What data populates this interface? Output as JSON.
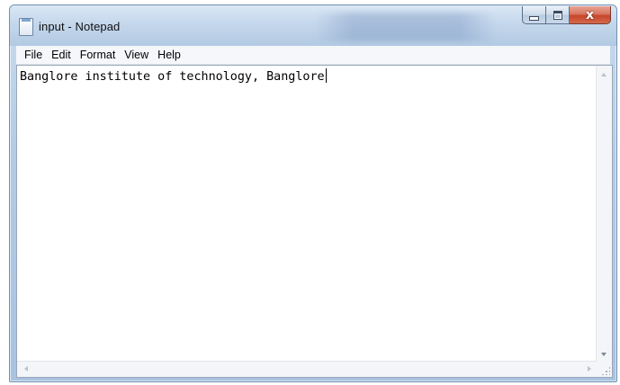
{
  "window": {
    "title": "input - Notepad",
    "close_glyph": "x",
    "icons": {
      "app": "notepad-icon",
      "minimize": "minimize-icon",
      "maximize": "maximize-icon",
      "close": "close-icon"
    },
    "colors": {
      "titlebar": "#c4d7ec",
      "close_button": "#c7452b",
      "editor_bg": "#ffffff"
    }
  },
  "menubar": {
    "items": [
      {
        "label": "File"
      },
      {
        "label": "Edit"
      },
      {
        "label": "Format"
      },
      {
        "label": "View"
      },
      {
        "label": "Help"
      }
    ]
  },
  "editor": {
    "content": "Banglore institute of technology, Banglore"
  }
}
